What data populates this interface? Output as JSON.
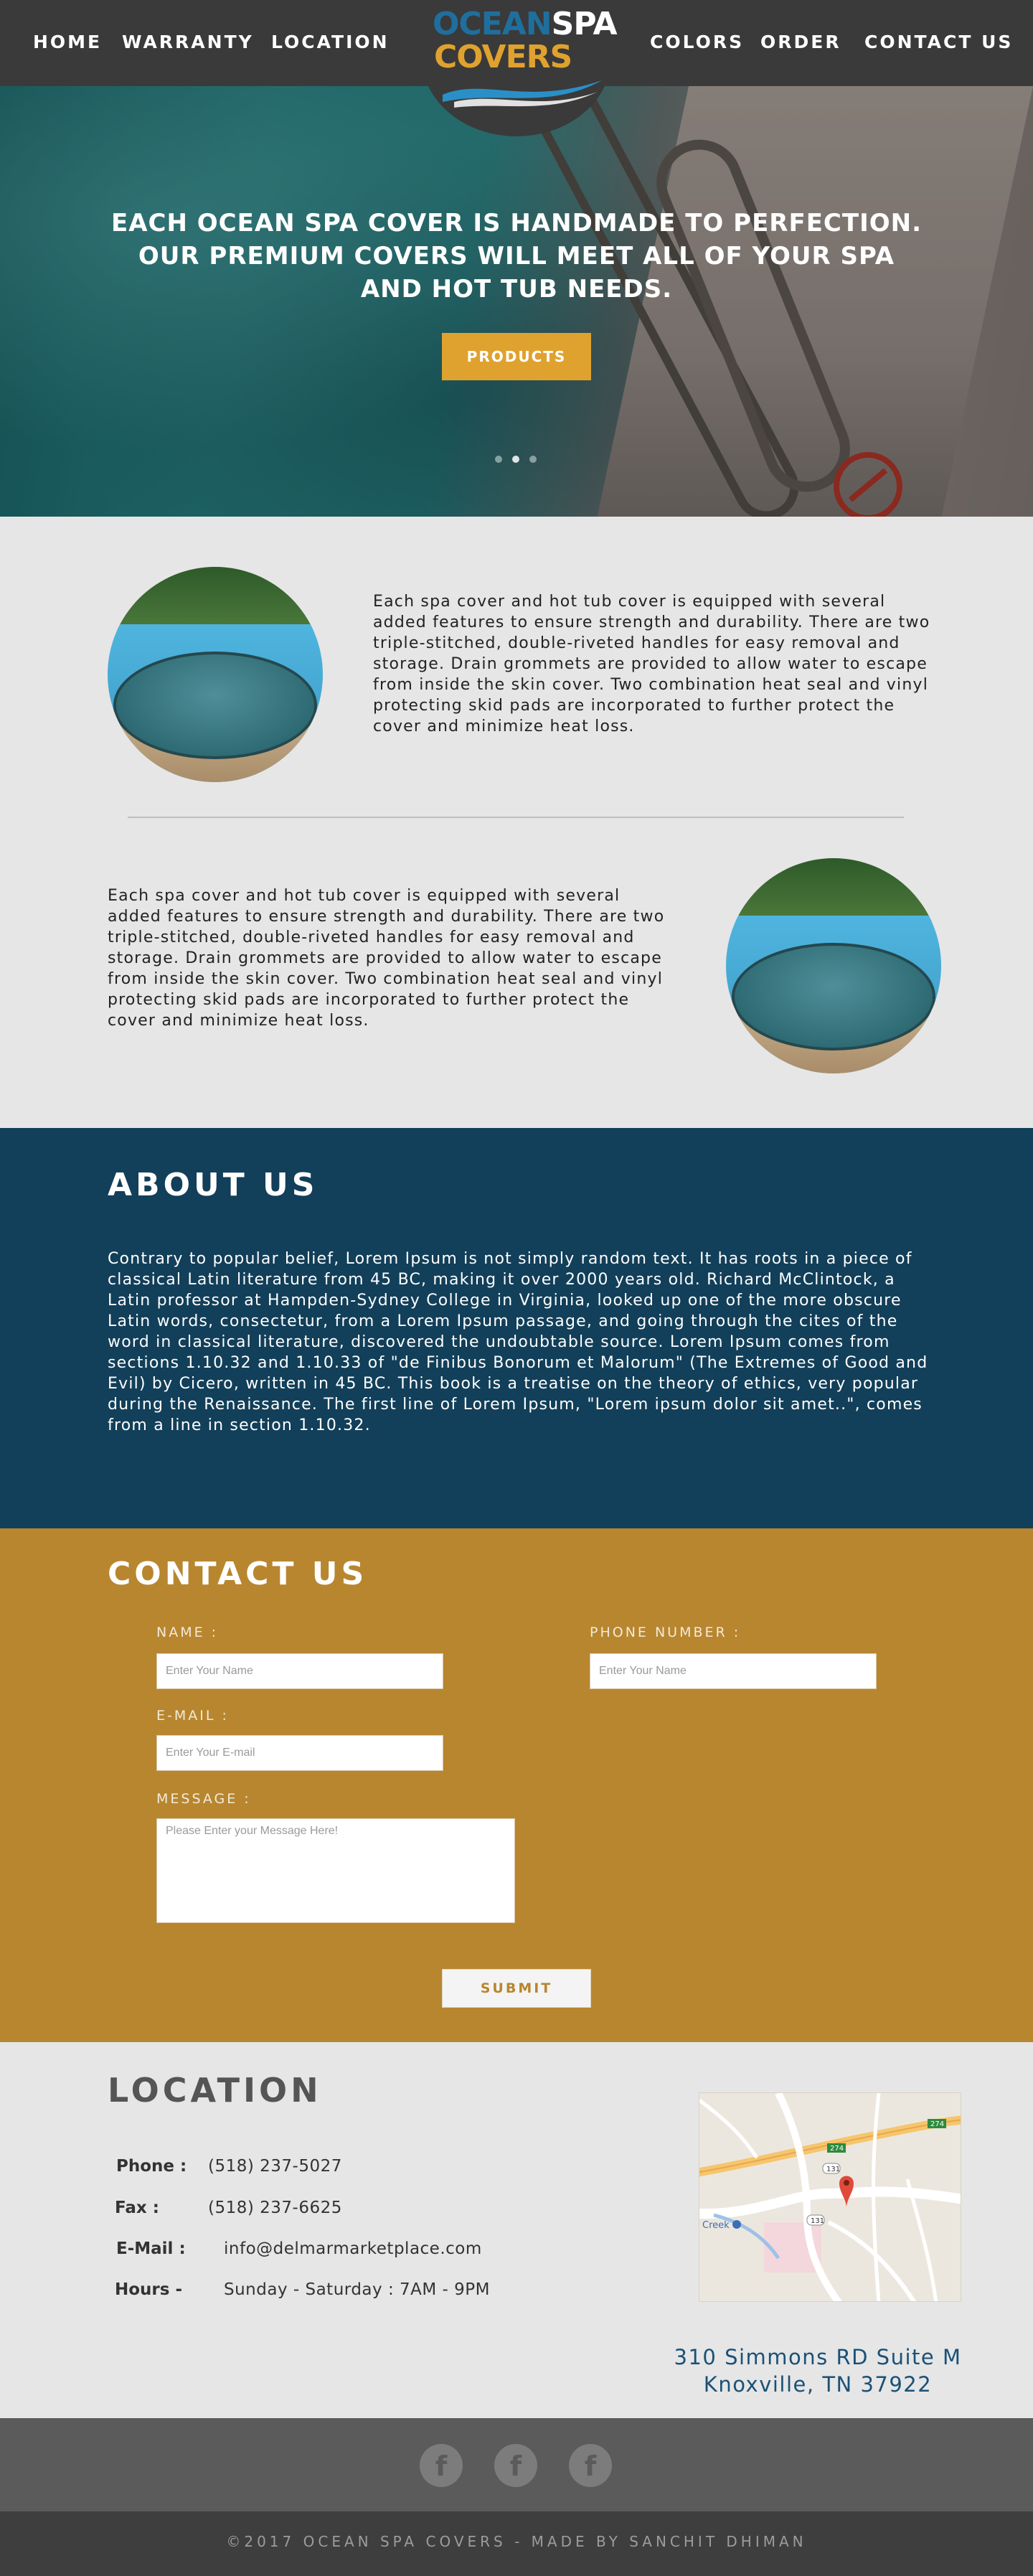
{
  "nav": {
    "left": [
      "HOME",
      "WARRANTY",
      "LOCATION"
    ],
    "right": [
      "COLORS",
      "ORDER",
      "CONTACT US"
    ]
  },
  "logo": {
    "word1": "OCEAN",
    "word2": "SPA",
    "word3": "COVERS"
  },
  "hero": {
    "headline": "EACH OCEAN SPA COVER IS HANDMADE TO PERFECTION. OUR PREMIUM COVERS WILL MEET ALL OF YOUR SPA AND HOT TUB NEEDS.",
    "button": "PRODUCTS",
    "slides_total": 3,
    "active_slide": 2
  },
  "features": {
    "text1": "Each spa cover and hot tub cover is equipped with several added features to ensure strength and durability. There are two triple-stitched, double-riveted handles for easy removal and storage. Drain grommets are provided to allow water to escape from inside the skin cover. Two combination heat seal and vinyl protecting skid pads are incorporated to further protect the cover and minimize heat loss.",
    "text2": "Each spa cover and hot tub cover is equipped with several added features to ensure strength and durability. There are two triple-stitched, double-riveted handles for easy removal and storage. Drain grommets are provided to allow water to escape from inside the skin cover. Two combination heat seal and vinyl protecting skid pads are incorporated to further protect the cover and minimize heat loss."
  },
  "about": {
    "title": "ABOUT US",
    "body": "Contrary to popular belief, Lorem Ipsum is not simply random text. It has roots in a piece of classical Latin literature from 45 BC, making it over 2000 years old. Richard McClintock, a Latin professor at Hampden-Sydney College in Virginia, looked up one of the more obscure Latin words, consectetur, from a Lorem Ipsum passage, and going through the cites of the word in classical literature, discovered the undoubtable source. Lorem Ipsum comes from sections 1.10.32 and 1.10.33 of \"de Finibus Bonorum et Malorum\" (The Extremes of Good and Evil) by Cicero, written in 45 BC. This book is a treatise on the theory of ethics, very popular during the Renaissance. The first line of Lorem Ipsum, \"Lorem ipsum dolor sit amet..\", comes from a line in section 1.10.32."
  },
  "contact": {
    "title": "CONTACT US",
    "name_label": "NAME :",
    "name_placeholder": "Enter Your Name",
    "phone_label": "PHONE NUMBER :",
    "phone_placeholder": "Enter Your Name",
    "email_label": "E-MAIL :",
    "email_placeholder": "Enter Your E-mail",
    "message_label": "MESSAGE :",
    "message_placeholder": "Please Enter your Message Here!",
    "submit": "SUBMIT"
  },
  "location": {
    "title": "LOCATION",
    "phone_label": "Phone :",
    "phone": "(518) 237-5027",
    "fax_label": "Fax :",
    "fax": "(518) 237-6625",
    "email_label": "E-Mail :",
    "email": "info@delmarmarketplace.com",
    "hours_label": "Hours -",
    "hours": "Sunday - Saturday : 7AM - 9PM",
    "address_line1": "310 Simmons RD Suite M",
    "address_line2": "Knoxville, TN 37922",
    "map": {
      "creek_label": "Creek",
      "route_labels": [
        "131",
        "131",
        "274",
        "274"
      ]
    }
  },
  "footer": {
    "social_icons": [
      "f",
      "f",
      "f"
    ],
    "copyright": "©2017 OCEAN SPA COVERS - MADE BY SANCHIT DHIMAN"
  },
  "colors": {
    "accent": "#e0a22e",
    "nav_bg": "#3a3a3a",
    "about_bg": "#123f59",
    "contact_bg": "#b8862f",
    "address_text": "#1a5177"
  }
}
